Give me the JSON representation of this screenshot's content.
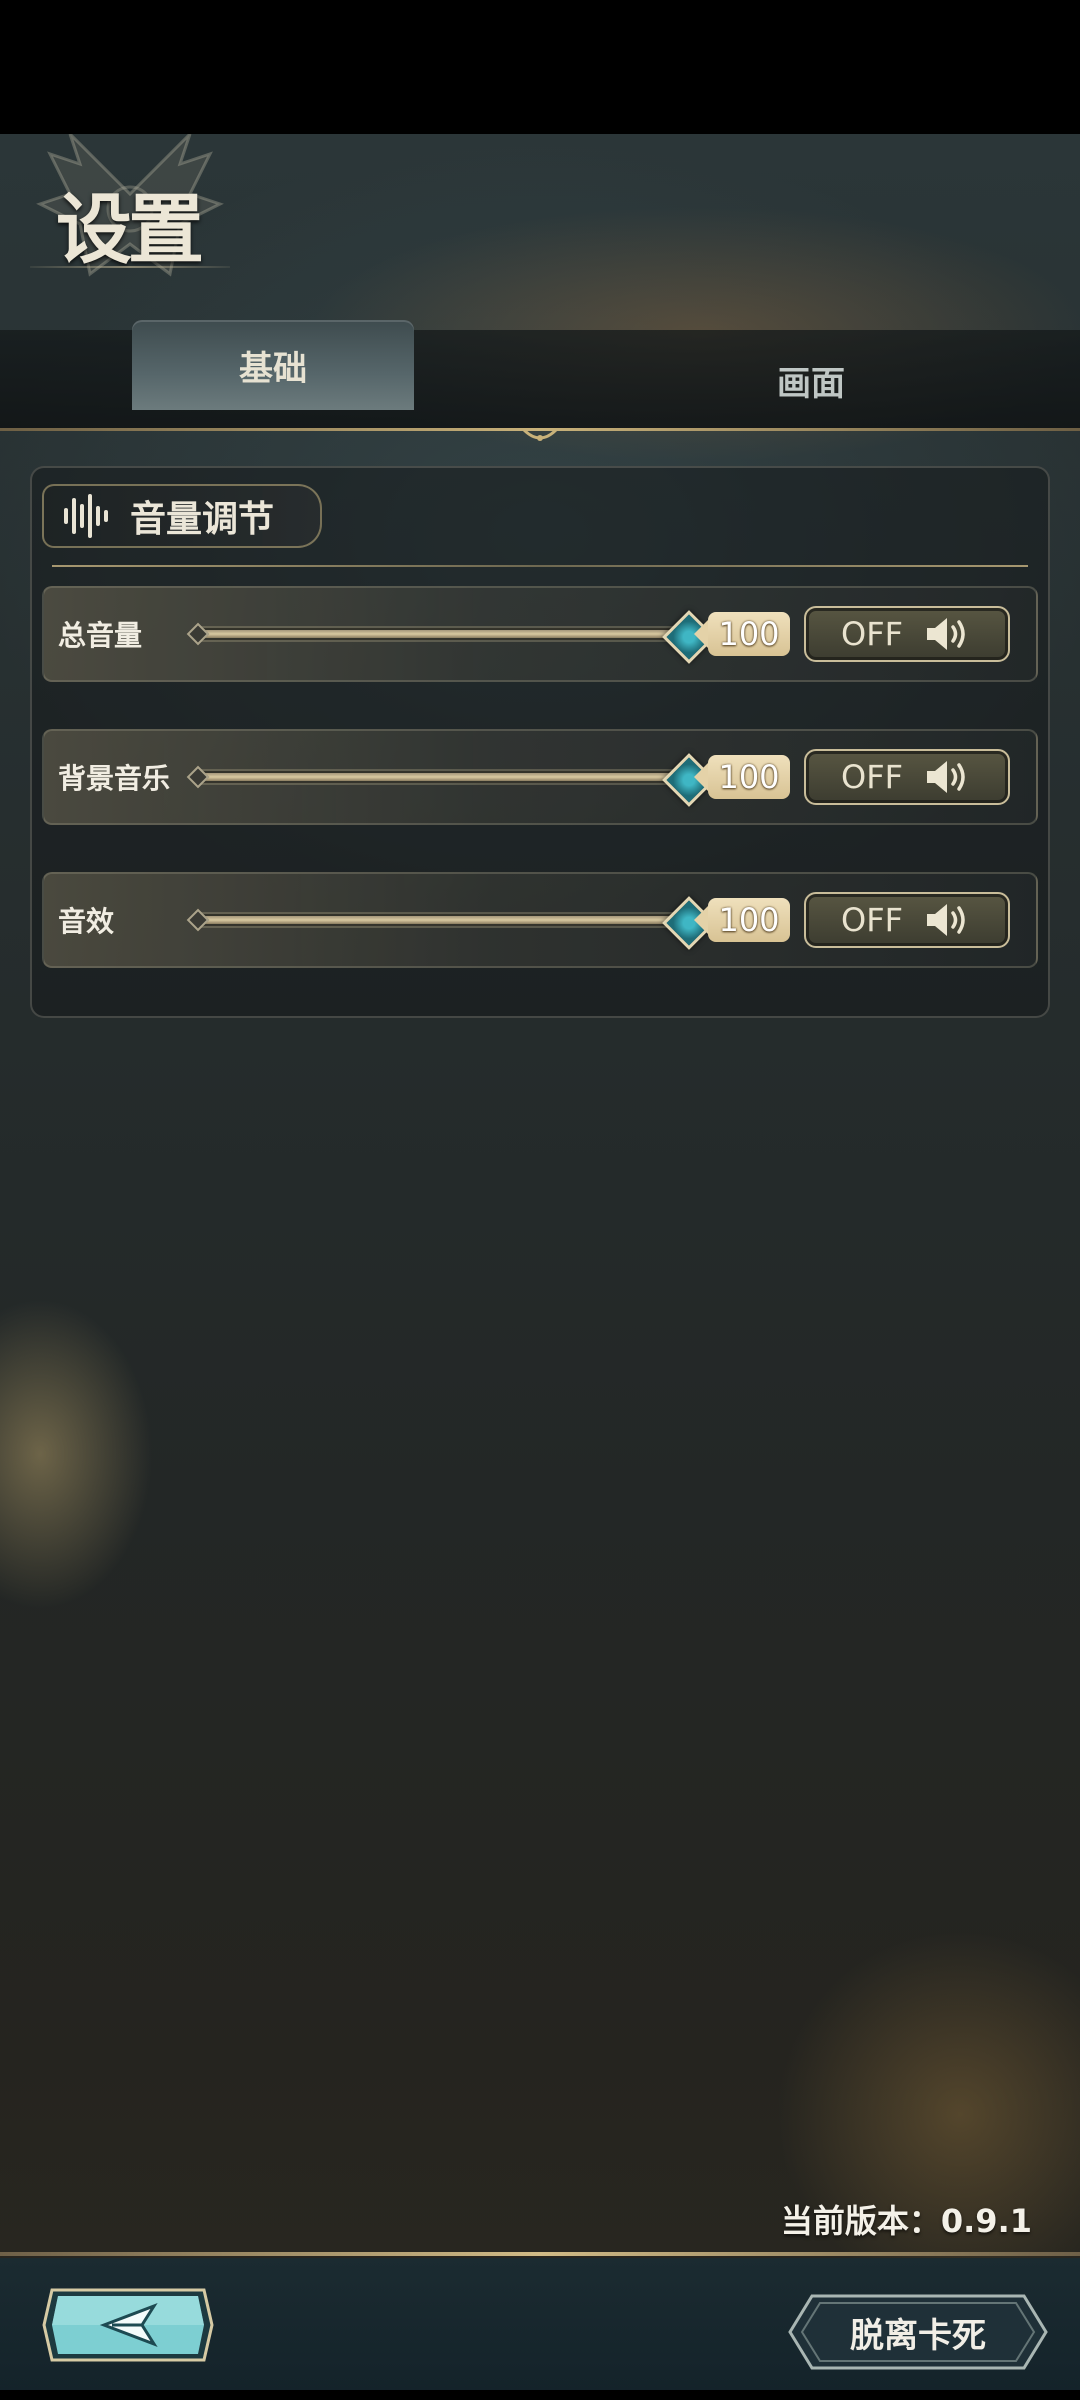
{
  "header": {
    "title": "设置"
  },
  "tabs": [
    {
      "label": "基础",
      "active": true
    },
    {
      "label": "画面",
      "active": false
    }
  ],
  "volume_section": {
    "title": "音量调节",
    "icon": "sound-wave-icon",
    "rows": [
      {
        "label": "总音量",
        "value": "100",
        "value_fraction": 1.0,
        "toggle_label": "OFF",
        "toggle_icon": "speaker-icon"
      },
      {
        "label": "背景音乐",
        "value": "100",
        "value_fraction": 1.0,
        "toggle_label": "OFF",
        "toggle_icon": "speaker-icon"
      },
      {
        "label": "音效",
        "value": "100",
        "value_fraction": 1.0,
        "toggle_label": "OFF",
        "toggle_icon": "speaker-icon"
      }
    ]
  },
  "footer": {
    "version_text": "当前版本：0.9.1",
    "back_icon": "back-arrow-icon",
    "exit_label": "脱离卡死"
  },
  "colors": {
    "accent_gold": "#c9b27a",
    "thumb_teal": "#3fb6c4",
    "back_button_teal": "#8fd6d8"
  }
}
